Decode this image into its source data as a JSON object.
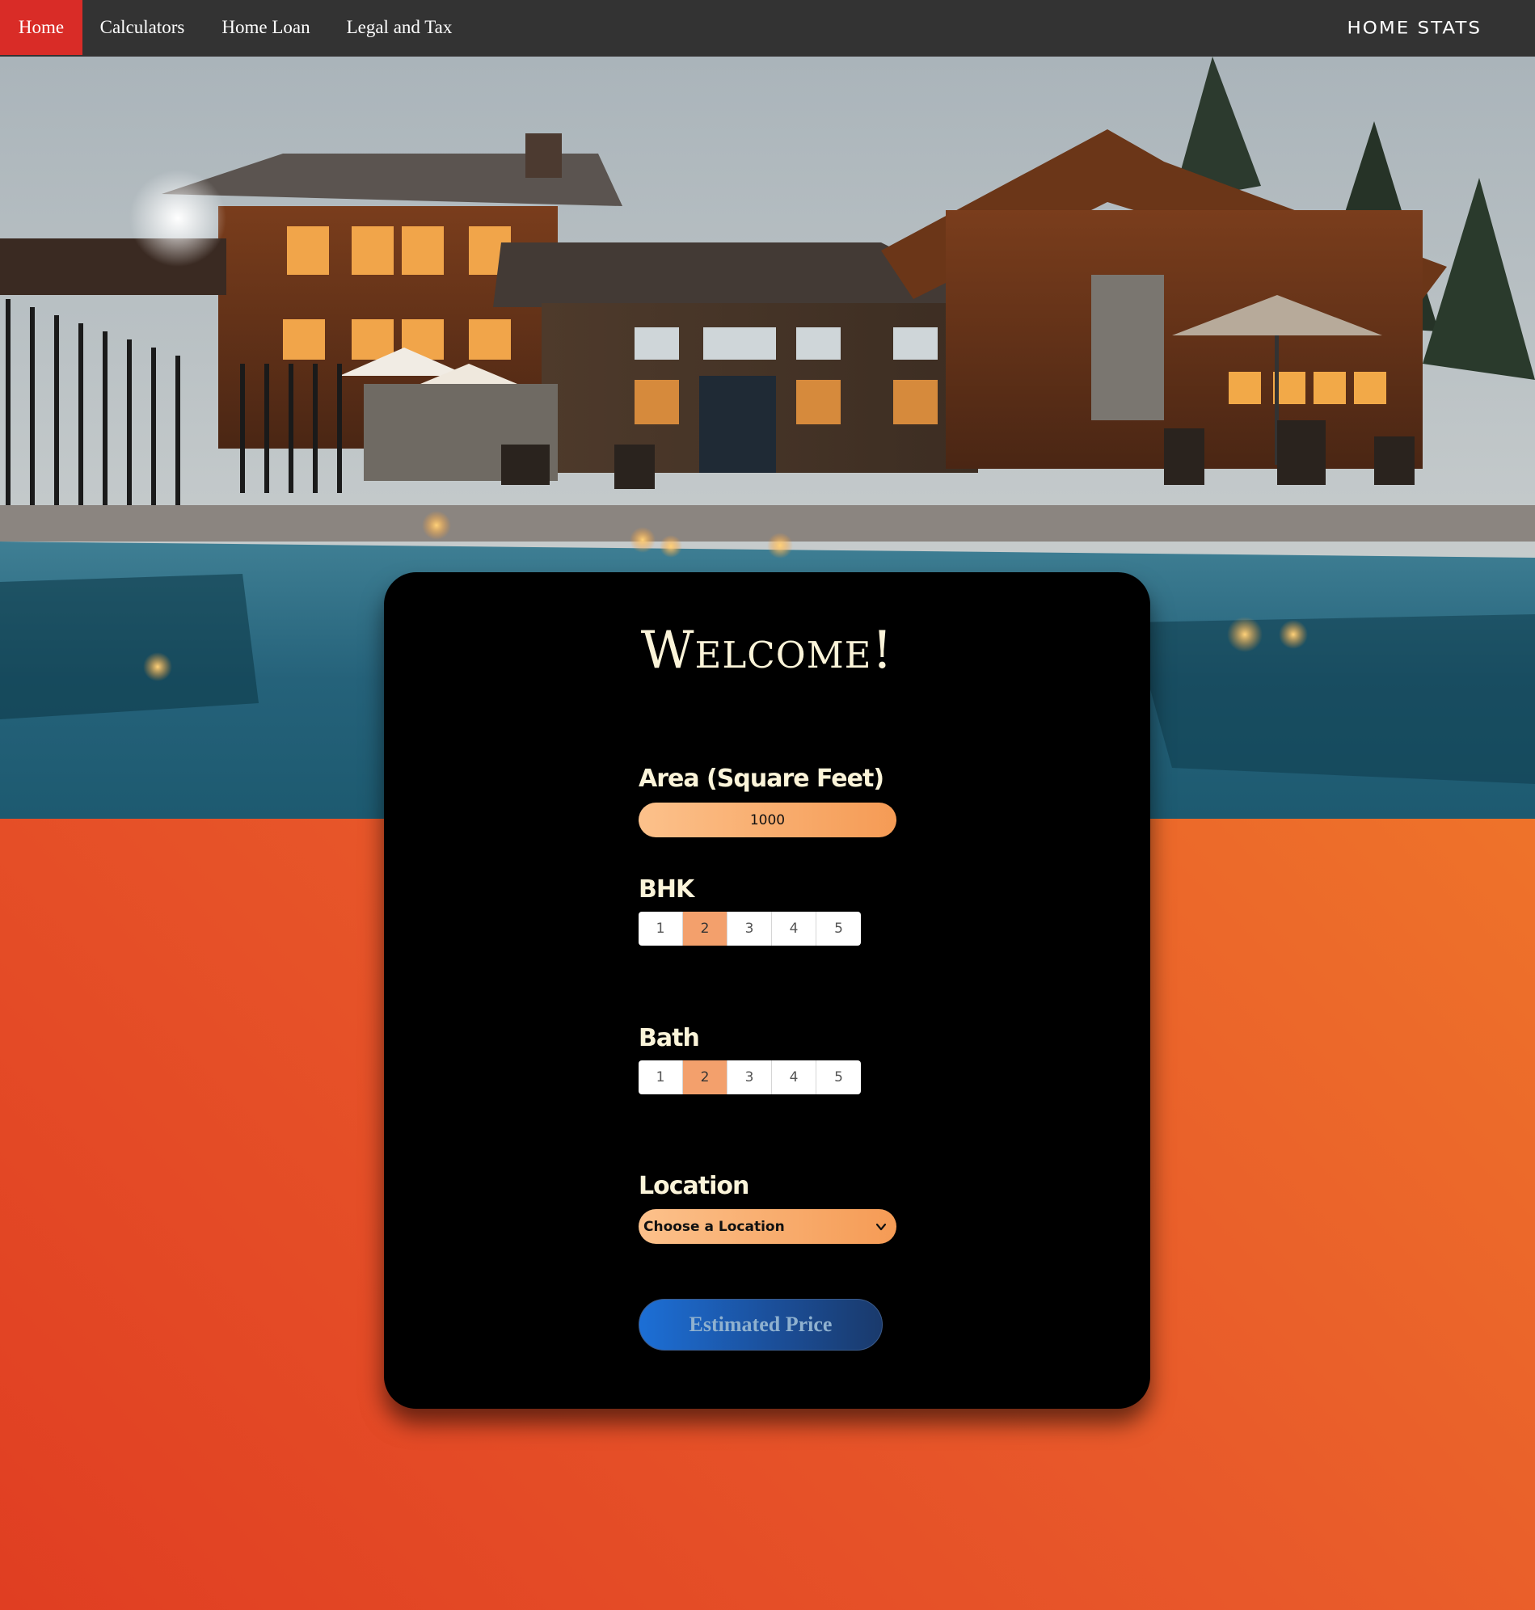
{
  "nav": {
    "items": [
      {
        "label": "Home",
        "active": true
      },
      {
        "label": "Calculators",
        "active": false
      },
      {
        "label": "Home Loan",
        "active": false
      },
      {
        "label": "Legal and Tax",
        "active": false
      }
    ],
    "brand": "HOME STATS"
  },
  "colors": {
    "nav_bg": "#333333",
    "nav_active": "#d92c27",
    "accent_orange": "#f59b55",
    "card_bg": "#000000",
    "label_text": "#fbf4d9",
    "button_blue": "#1c6fd6"
  },
  "hero": {
    "image": "house-with-pool-photo"
  },
  "form": {
    "title": "Welcome!",
    "area": {
      "label": "Area (Square Feet)",
      "value": "1000"
    },
    "bhk": {
      "label": "BHK",
      "options": [
        "1",
        "2",
        "3",
        "4",
        "5"
      ],
      "selected": "2"
    },
    "bath": {
      "label": "Bath",
      "options": [
        "1",
        "2",
        "3",
        "4",
        "5"
      ],
      "selected": "2"
    },
    "location": {
      "label": "Location",
      "selected_text": "Choose a Location",
      "icon": "chevron-down-icon"
    },
    "submit_label": "Estimated Price"
  }
}
